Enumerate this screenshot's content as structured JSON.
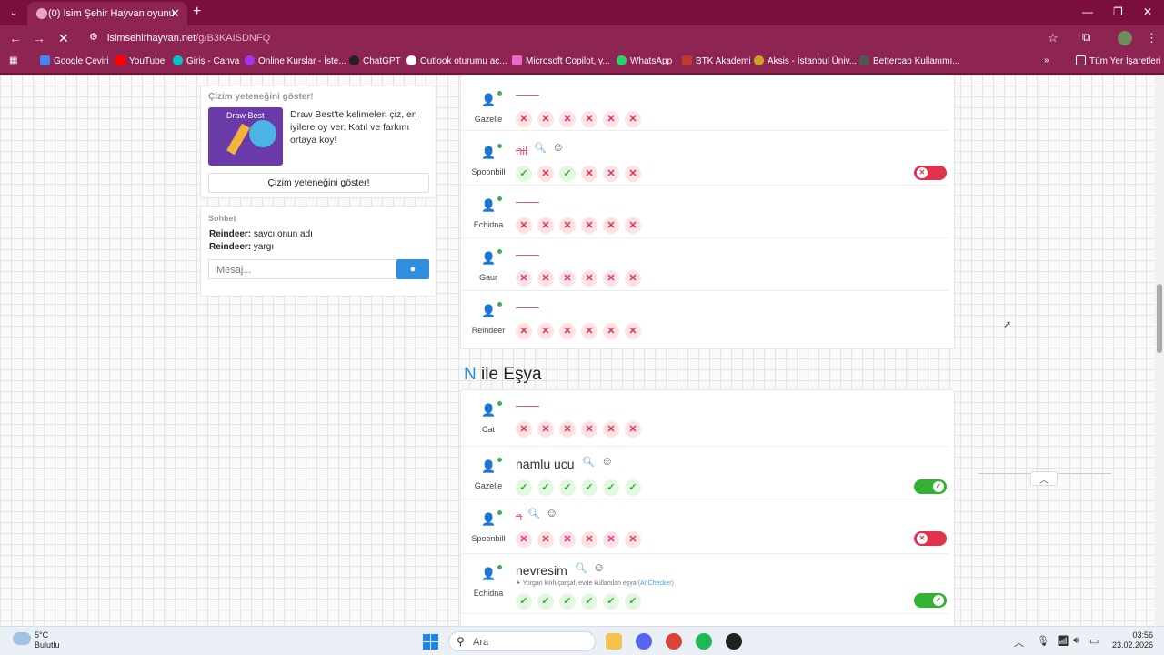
{
  "browser": {
    "tab_title": "(0) İsim Şehir Hayvan oyununa ...",
    "url_domain": "isimsehirhayvan.net",
    "url_path": "/g/B3KAISDNFQ",
    "bookmarks": [
      {
        "label": "Google Çeviri",
        "color": "#4285f4"
      },
      {
        "label": "YouTube",
        "color": "#ff0000"
      },
      {
        "label": "Giriş - Canva",
        "color": "#00c4cc"
      },
      {
        "label": "Online Kurslar - İste...",
        "color": "#a435f0"
      },
      {
        "label": "ChatGPT",
        "color": "#222222"
      },
      {
        "label": "Outlook oturumu aç...",
        "color": "#0078d4"
      },
      {
        "label": "Microsoft Copilot, y...",
        "color": "#e86ac6"
      },
      {
        "label": "WhatsApp",
        "color": "#25d366"
      },
      {
        "label": "BTK Akademi",
        "color": "#c0392b"
      },
      {
        "label": "Aksis - İstanbul Üniv...",
        "color": "#c9a227"
      },
      {
        "label": "Bettercap Kullanımı...",
        "color": "#555555"
      }
    ],
    "all_bookmarks": "Tüm Yer İşaretleri"
  },
  "sidebar": {
    "draw": {
      "title": "Çizim yeteneğini göster!",
      "image_text": "Draw Best",
      "description": "Draw Best'te kelimeleri çiz, en iyilere oy ver. Katıl ve farkını ortaya koy!",
      "button": "Çizim yeteneğini göster!"
    },
    "chat": {
      "title": "Sohbet",
      "messages": [
        {
          "user": "Reindeer:",
          "text": " savcı onun adı"
        },
        {
          "user": "Reindeer:",
          "text": " yargı"
        }
      ],
      "placeholder": "Mesaj..."
    }
  },
  "section_prev": {
    "rows": [
      {
        "player": "Gazelle",
        "answer": "",
        "marks": [
          "n",
          "n",
          "n",
          "n",
          "n",
          "n"
        ]
      },
      {
        "player": "Spoonbill",
        "answer": "nil",
        "marks": [
          "y",
          "n",
          "y",
          "n",
          "n",
          "n"
        ],
        "toggle": "off"
      },
      {
        "player": "Echidna",
        "answer": "",
        "marks": [
          "n",
          "n",
          "n",
          "n",
          "n",
          "n"
        ]
      },
      {
        "player": "Gaur",
        "answer": "",
        "marks": [
          "n",
          "n",
          "n",
          "n",
          "n",
          "n"
        ]
      },
      {
        "player": "Reindeer",
        "answer": "",
        "marks": [
          "n",
          "n",
          "n",
          "n",
          "n",
          "n"
        ]
      }
    ]
  },
  "section_esya": {
    "letter": "N",
    "title": " ile Eşya",
    "rows": [
      {
        "player": "Cat",
        "answer": "",
        "marks": [
          "n",
          "n",
          "n",
          "n",
          "n",
          "n"
        ]
      },
      {
        "player": "Gazelle",
        "answer": "namlu ucu",
        "marks": [
          "y",
          "y",
          "y",
          "y",
          "y",
          "y"
        ],
        "toggle": "on"
      },
      {
        "player": "Spoonbill",
        "answer": "n",
        "marks": [
          "n",
          "n",
          "n",
          "n",
          "n",
          "n"
        ],
        "toggle": "off"
      },
      {
        "player": "Echidna",
        "answer": "nevresim",
        "note": "Yorgan kılıfı/çarşaf, evde kullanılan eşya",
        "note_src": "(AI Checker)",
        "marks": [
          "y",
          "y",
          "y",
          "y",
          "y",
          "y"
        ],
        "toggle": "on"
      }
    ]
  },
  "taskbar": {
    "temp": "5°C",
    "weather": "Bulutlu",
    "search": "Ara",
    "time": "03:56",
    "date": "23.02.2026"
  }
}
